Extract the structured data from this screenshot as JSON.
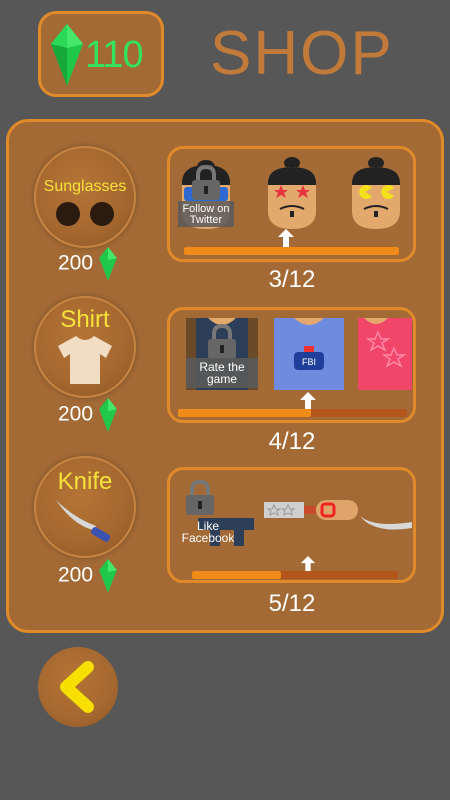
{
  "currency": {
    "amount": "110",
    "icon": "green-gem-icon",
    "color": "#34e35c"
  },
  "header": {
    "title": "SHOP"
  },
  "categories": [
    {
      "label": "Sunglasses",
      "price": "200",
      "progress_text": "3/12",
      "progress_fraction": 1.0,
      "lock_text": "Follow on Twitter",
      "items": [
        "locked-sunglasses",
        "star-sunglasses",
        "pacman-sunglasses"
      ]
    },
    {
      "label": "Shirt",
      "price": "200",
      "progress_text": "4/12",
      "progress_fraction": 0.58,
      "lock_text": "Rate the game",
      "items": [
        "locked-shirt",
        "fbi-shirt",
        "pink-star-shirt"
      ]
    },
    {
      "label": "Knife",
      "price": "200",
      "progress_text": "5/12",
      "progress_fraction": 0.43,
      "lock_text": "Like Facebook",
      "items": [
        "locked-gun",
        "star-knife",
        "curved-blade"
      ]
    }
  ],
  "colors": {
    "background": "#575757",
    "panel": "#a36a35",
    "panel_border": "#e08a2a",
    "title": "#c27a3a",
    "category_label": "#f7e23b",
    "back_arrow": "#f7e000"
  }
}
